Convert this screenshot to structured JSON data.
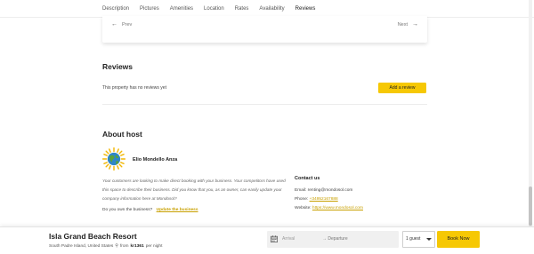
{
  "tabs": [
    {
      "label": "Description"
    },
    {
      "label": "Pictures"
    },
    {
      "label": "Amenities"
    },
    {
      "label": "Location"
    },
    {
      "label": "Rates"
    },
    {
      "label": "Availability"
    },
    {
      "label": "Reviews",
      "active": true
    }
  ],
  "pager": {
    "prev_label": "Prev",
    "next_label": "Next"
  },
  "reviews": {
    "title": "Reviews",
    "empty_text": "This property has no reviews yet",
    "add_button": "Add a review"
  },
  "host": {
    "title": "About host",
    "name": "Elio Mondello Anza",
    "description": "Your customers are looking to make direct booking with your business. Your competitors have used this space to describe their business. Did you know that you, as an owner, can easily update your company information here at Mondosol?",
    "own_question": "Do you own the business?",
    "update_link": "Update the business"
  },
  "contact": {
    "title": "Contact us",
    "email": "Email: renting@mondosol.com",
    "phone_label": "Phone:",
    "phone": "+34952167888",
    "website_label": "Website:",
    "website": "https://www.mondosol.com"
  },
  "booking": {
    "property_name": "Isla Grand Beach Resort",
    "location": "South Padre Island, United States",
    "price_prefix": "from",
    "price": "kr1361",
    "price_suffix": "per night",
    "arrival_placeholder": "Arrival",
    "departure_placeholder": "→ Departure",
    "guests": "1 guest",
    "book_button": "Book Now"
  },
  "colors": {
    "accent": "#f6c804",
    "link": "#c8a000"
  }
}
